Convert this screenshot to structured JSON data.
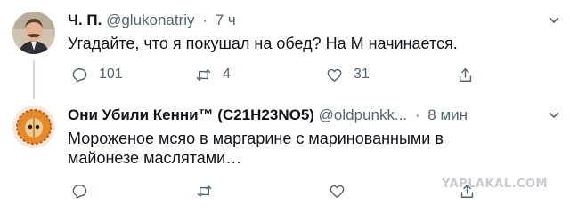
{
  "tweet1": {
    "avatar": "avatar-man-mustache",
    "name": "Ч. П.",
    "handle": "@glukonatriy",
    "separator": "·",
    "time": "7 ч",
    "text": "Угадайте, что я покушал на обед? На М начинается.",
    "reply_count": "101",
    "retweet_count": "4",
    "like_count": "31"
  },
  "tweet2": {
    "avatar": "avatar-kenny-orange-hood",
    "name": "Они Убили Кенни™ (C21H23NO5)",
    "handle": "@oldpunkk...",
    "separator": "·",
    "time": "8 мин",
    "text_line1": "Мороженое мсяо в маргарине с маринованными в",
    "text_line2": "майонезе маслятами…"
  },
  "watermark": "YAPLAKAL.COM",
  "colors": {
    "text": "#0f1419",
    "secondary": "#536471",
    "thread_line": "#cfd9de",
    "watermark": "#c8ccd2"
  },
  "icons": [
    "reply-icon",
    "retweet-icon",
    "like-icon",
    "share-icon",
    "chevron-down-icon"
  ]
}
